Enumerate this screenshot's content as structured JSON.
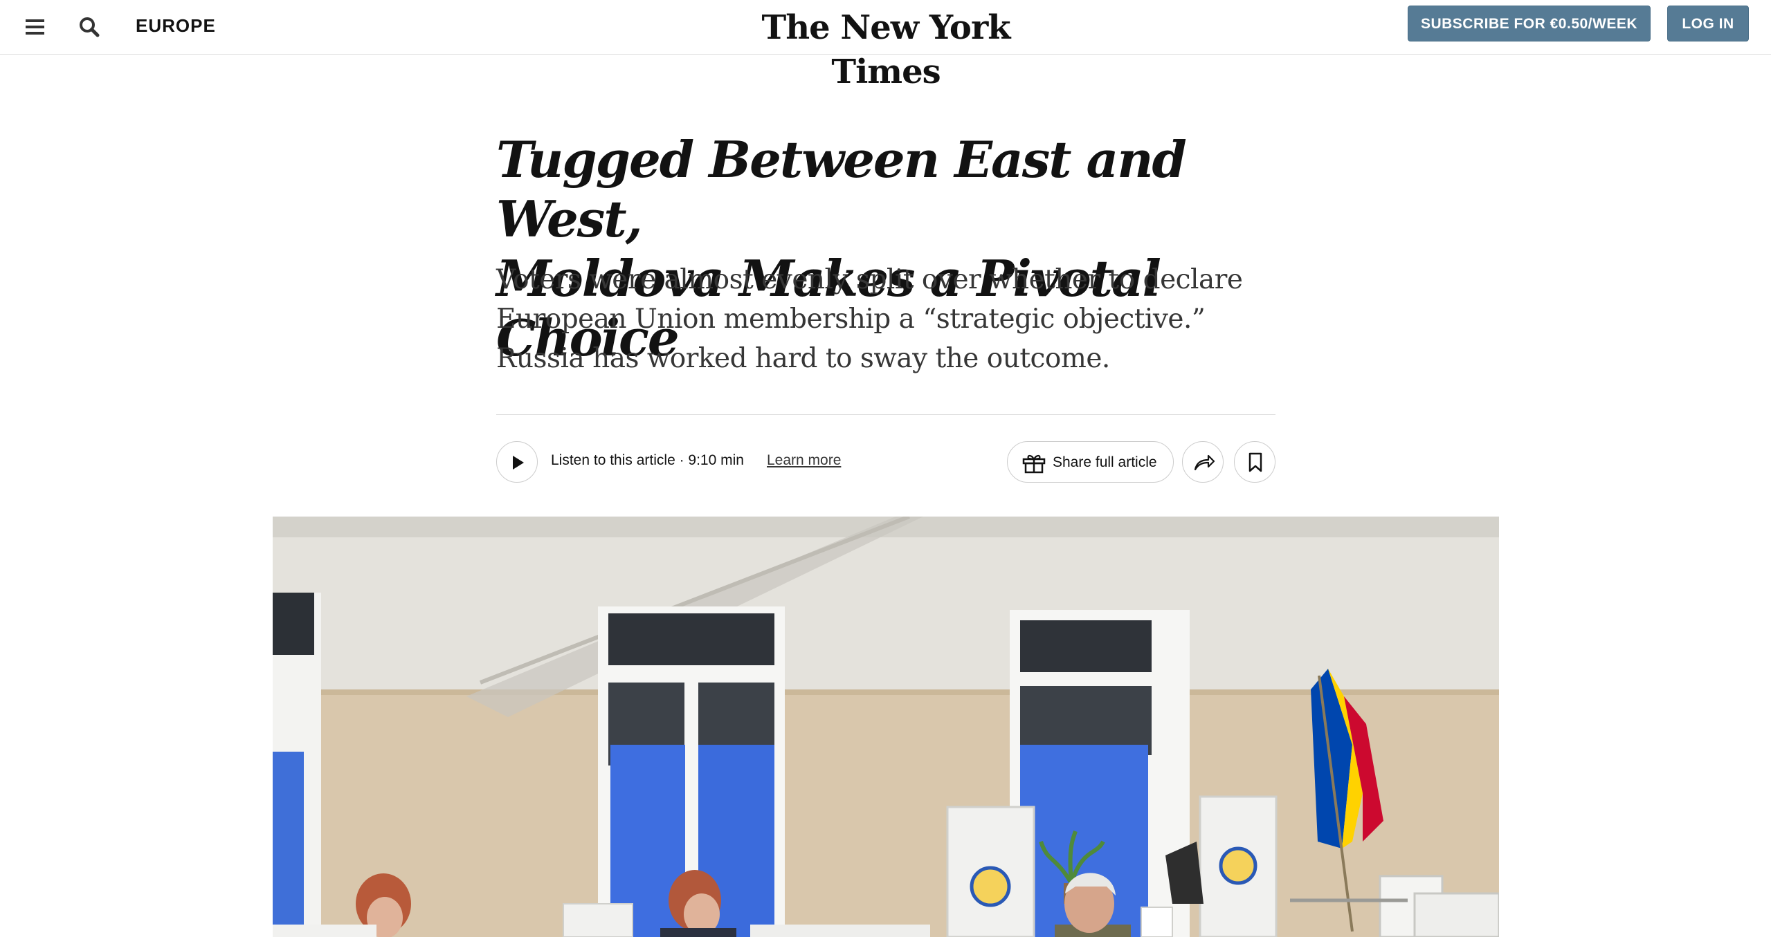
{
  "header": {
    "section": "EUROPE",
    "logo": "The New York Times",
    "subscribe_label": "SUBSCRIBE FOR €0.50/WEEK",
    "login_label": "LOG IN"
  },
  "article": {
    "headline_line1": "Tugged Between East and West,",
    "headline_line2": "Moldova Makes a Pivotal Choice",
    "summary": "Voters were almost evenly split over whether to declare European Union membership a “strategic objective.” Russia has worked hard to sway the outcome."
  },
  "toolbar": {
    "listen_text": "Listen to this article · 9:10 min",
    "learn_more": "Learn more",
    "share_full": "Share full article"
  },
  "icons": {
    "menu": "hamburger-menu-icon",
    "search": "search-icon",
    "play": "play-icon",
    "gift": "gift-icon",
    "share": "share-arrow-icon",
    "bookmark": "bookmark-icon"
  },
  "colors": {
    "button_bg": "#567b95",
    "text": "#121212",
    "flag_blue": "#0046ae",
    "flag_yellow": "#ffd200",
    "flag_red": "#cc092f"
  }
}
